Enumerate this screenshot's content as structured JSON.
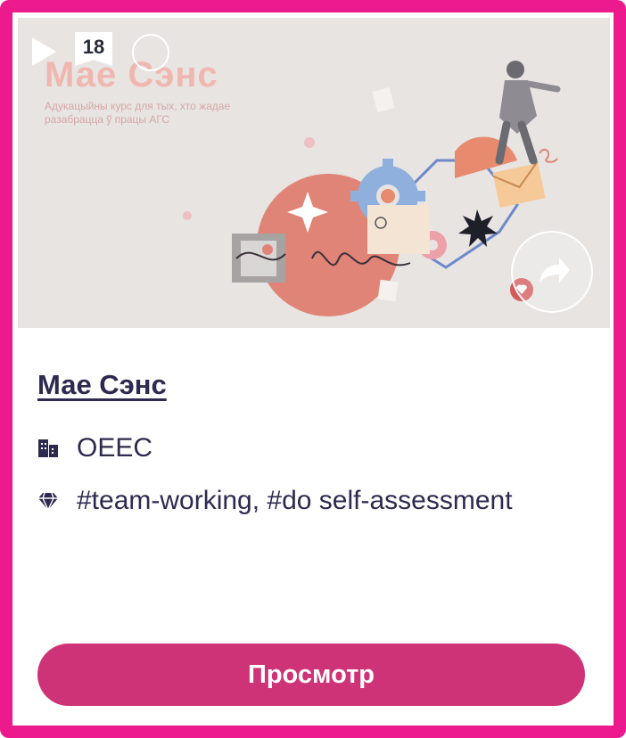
{
  "thumbnail": {
    "title": "Мае Сэнс",
    "subtitle": "Адукацыйны курс для тых, хто жадае разабрацца ў працы АГС",
    "age_rating": "18",
    "play_icon": "play-icon",
    "share_icon": "share-icon"
  },
  "card": {
    "title": "Мае Сэнс",
    "organization": "OEEC",
    "organization_icon": "building-icon",
    "tags": "#team-working, #do self-assessment",
    "tags_icon": "gem-icon",
    "view_button_label": "Просмотр"
  },
  "colors": {
    "frame": "#ec1a8c",
    "button": "#cf3377",
    "text": "#2e2a4f",
    "thumbnail_bg": "#e7e4e2"
  }
}
